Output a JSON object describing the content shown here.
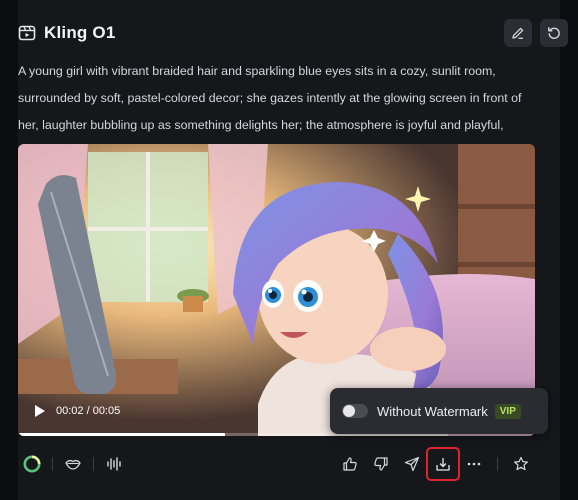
{
  "header": {
    "title": "Kling O1",
    "title_icon": "video-clip-icon",
    "edit_icon": "pencil-icon",
    "regenerate_icon": "refresh-icon"
  },
  "prompt": {
    "text": "A young girl with vibrant braided hair and sparkling blue eyes sits in a cozy, sunlit room, surrounded by soft, pastel-colored decor; she gazes intently at the glowing screen in front of her, laughter bubbling up as something delights her; the atmosphere is joyful and playful,"
  },
  "player": {
    "time": "00:02 / 00:05",
    "progress_fraction": 0.4,
    "play_icon": "play-icon"
  },
  "watermark_popup": {
    "label": "Without Watermark",
    "badge": "VIP",
    "toggle_on": false
  },
  "toolbar": {
    "left_icons": [
      "model-logo-icon",
      "lips-icon",
      "audio-wave-icon"
    ],
    "right_icons": [
      "thumbs-up-icon",
      "thumbs-down-icon",
      "send-icon",
      "download-icon",
      "more-icon",
      "star-icon"
    ],
    "highlighted": "download-icon"
  },
  "colors": {
    "background": "#16171b",
    "button_bg": "#2b2d33",
    "highlight": "#e0242d",
    "vip_text": "#b9e36b"
  }
}
